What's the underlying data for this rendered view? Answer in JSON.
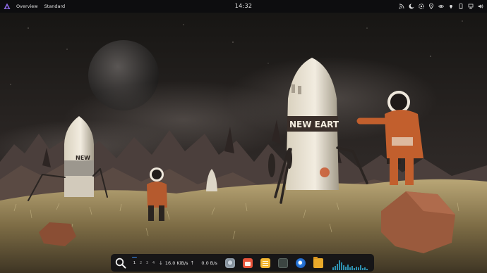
{
  "topbar": {
    "logo_icon": "distro-logo-icon",
    "overview_label": "Overview",
    "layout_label": "Standard",
    "clock": "14:32",
    "tray_icons": [
      "rss-icon",
      "moon-icon",
      "settings-icon",
      "location-icon",
      "eye-icon",
      "pin-icon",
      "phone-icon",
      "network-icon",
      "volume-icon"
    ]
  },
  "dock": {
    "search_icon": "search-icon",
    "workspaces": [
      "1",
      "2",
      "3",
      "4"
    ],
    "active_workspace": "1",
    "download_arrow": "↓",
    "download_speed": "16.0 KiB/s",
    "upload_arrow": "↑",
    "upload_speed": "0.0 B/s",
    "apps": [
      "settings-app-icon",
      "calendar-app-icon",
      "notes-app-icon",
      "terminal-app-icon",
      "browser-app-icon",
      "files-app-icon"
    ],
    "accent_color": "#3b8ff5"
  }
}
